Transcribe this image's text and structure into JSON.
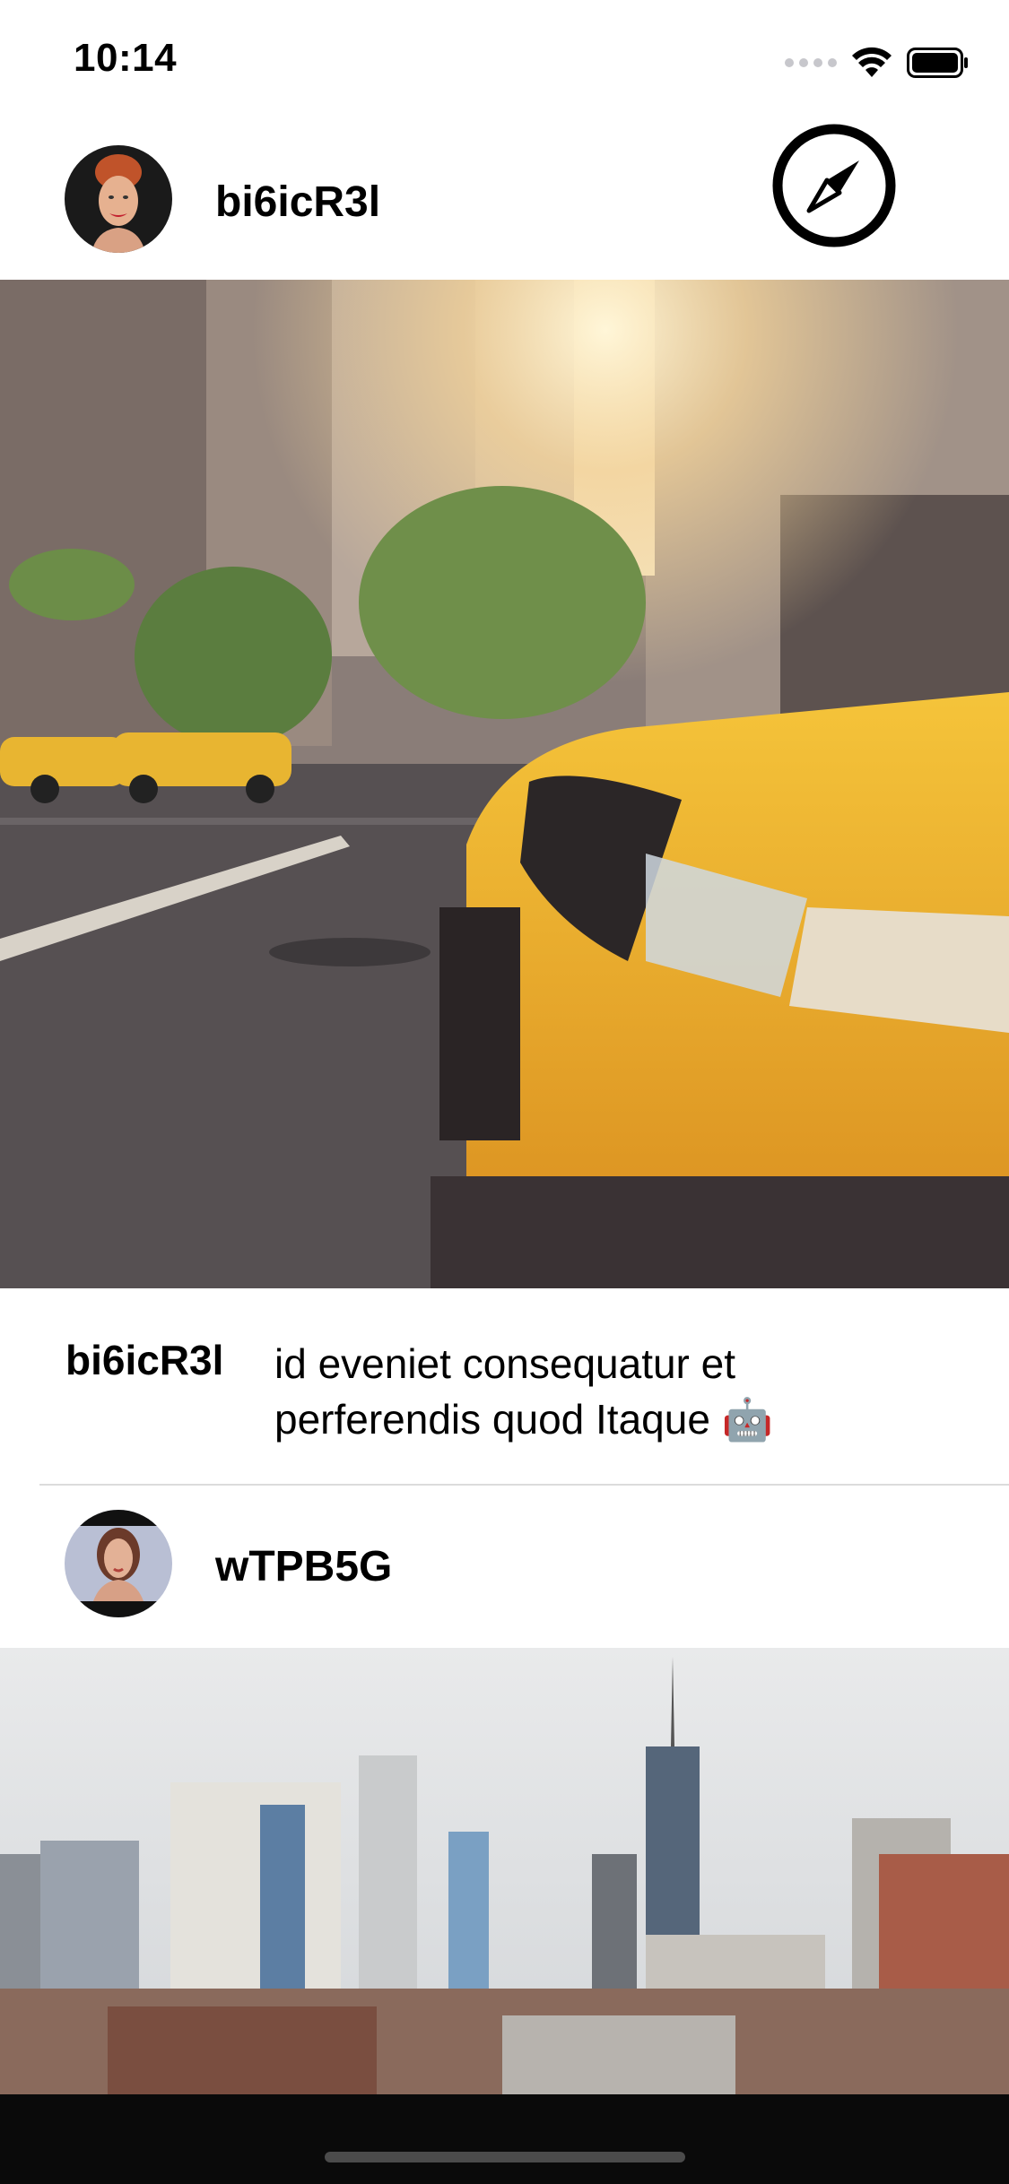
{
  "status_bar": {
    "time": "10:14",
    "icons": [
      "cellular-signal-icon",
      "wifi-icon",
      "battery-icon"
    ]
  },
  "header_action": {
    "icon": "compass-icon"
  },
  "posts": [
    {
      "username": "bi6icR3l",
      "avatar": "avatar-woman-red-hair",
      "photo": "new-york-street-yellow-taxi",
      "caption_user": "bi6icR3l",
      "caption_text": "id eveniet consequatur et perferendis quod Itaque 🤖"
    },
    {
      "username": "wTPB5G",
      "avatar": "avatar-woman-brown-hair",
      "photo": "new-york-skyline"
    }
  ],
  "colors": {
    "background": "#ffffff",
    "text": "#000000",
    "divider": "#dcdcdc",
    "home_bar_background": "#0a0a0a"
  }
}
